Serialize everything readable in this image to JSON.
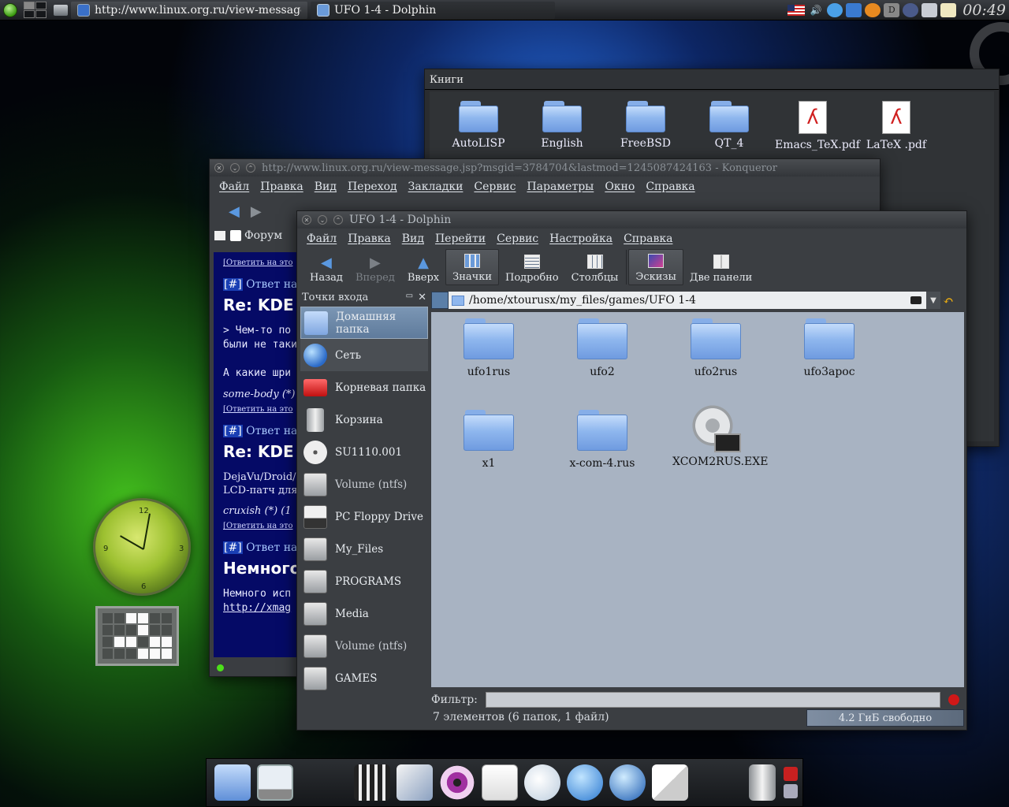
{
  "top_panel": {
    "tasks": [
      {
        "label": "http://www.linux.org.ru/view-message.jsp?m",
        "icon": "konqueror-icon"
      },
      {
        "label": "UFO 1-4 - Dolphin",
        "icon": "dolphin-icon"
      }
    ],
    "clock": "00:49"
  },
  "clock_widget": {
    "n12": "12",
    "n3": "3",
    "n6": "6",
    "n9": "9"
  },
  "books_window": {
    "title": "Книги",
    "items": [
      {
        "label": "AutoLISP",
        "kind": "folder"
      },
      {
        "label": "English",
        "kind": "folder"
      },
      {
        "label": "FreeBSD",
        "kind": "folder"
      },
      {
        "label": "QT_4",
        "kind": "folder"
      },
      {
        "label": "Emacs_TeX.pdf",
        "kind": "pdf"
      },
      {
        "label": "LaTeX .pdf",
        "kind": "pdf"
      }
    ]
  },
  "konqueror": {
    "title": "http://www.linux.org.ru/view-message.jsp?msgid=3784704&lastmod=1245087424163 - Konqueror",
    "menu": [
      "Файл",
      "Правка",
      "Вид",
      "Переход",
      "Закладки",
      "Сервис",
      "Параметры",
      "Окно",
      "Справка"
    ],
    "tab_label": "Форум",
    "content": {
      "reply_link": "[Ответить на это",
      "hdr_prefix": "[#]",
      "hdr_text": " Ответ на: ",
      "hdr_link": "R",
      "big1": "Re: KDE",
      "mono1": "> Чем-то по",
      "mono2": "были не таки",
      "mono3": "А какие шри",
      "author1": "some-body (*)",
      "big2": "Re: KDE",
      "text2a": "DejaVu/Droid/I",
      "text2b": "LCD-патч для",
      "author2": "cruxish  (*) (1",
      "big3": "Немного",
      "mono4": "Немного исп",
      "mono5": "http://xmag"
    }
  },
  "dolphin": {
    "title": "UFO 1-4 - Dolphin",
    "menu": [
      "Файл",
      "Правка",
      "Вид",
      "Перейти",
      "Сервис",
      "Настройка",
      "Справка"
    ],
    "toolbar": {
      "back": "Назад",
      "forward": "Вперед",
      "up": "Вверх",
      "icons": "Значки",
      "details": "Подробно",
      "columns": "Столбцы",
      "preview": "Эскизы",
      "split": "Две панели"
    },
    "places_title": "Точки входа",
    "places": [
      {
        "label": "Домашняя папка",
        "icon": "home-folder-icon"
      },
      {
        "label": "Сеть",
        "icon": "network-icon"
      },
      {
        "label": "Корневая папка",
        "icon": "root-folder-icon"
      },
      {
        "label": "Корзина",
        "icon": "trash-icon"
      },
      {
        "label": "SU1110.001",
        "icon": "cd-icon"
      },
      {
        "label": "Volume (ntfs)",
        "icon": "drive-icon"
      },
      {
        "label": "PC Floppy Drive",
        "icon": "floppy-icon"
      },
      {
        "label": "My_Files",
        "icon": "drive-icon"
      },
      {
        "label": "PROGRAMS",
        "icon": "drive-icon"
      },
      {
        "label": "Media",
        "icon": "drive-icon"
      },
      {
        "label": "Volume (ntfs)",
        "icon": "drive-icon"
      },
      {
        "label": "GAMES",
        "icon": "drive-icon"
      }
    ],
    "path": "/home/xtourusx/my_files/games/UFO 1-4",
    "files": [
      {
        "label": "ufo1rus",
        "kind": "folder"
      },
      {
        "label": "ufo2",
        "kind": "folder"
      },
      {
        "label": "ufo2rus",
        "kind": "folder"
      },
      {
        "label": "ufo3apoc",
        "kind": "folder"
      },
      {
        "label": "x1",
        "kind": "folder"
      },
      {
        "label": "x-com-4.rus",
        "kind": "folder"
      },
      {
        "label": "XCOM2RUS.EXE",
        "kind": "executable"
      }
    ],
    "filter_label": "Фильтр:",
    "filter_value": "",
    "status": "7 элементов (6 папок, 1 файл)",
    "free_space": "4.2 ГиБ свободно"
  },
  "colors": {
    "selection": "#6a86a8",
    "view_bg": "#a8b3c2",
    "folder": "#8fb7ee"
  }
}
